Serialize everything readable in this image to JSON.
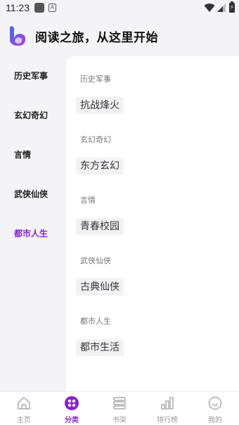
{
  "status_bar": {
    "time": "11:23",
    "a_badge": "A"
  },
  "header": {
    "title": "阅读之旅，从这里开始"
  },
  "categories": [
    {
      "label": "历史军事"
    },
    {
      "label": "玄幻奇幻"
    },
    {
      "label": "言情"
    },
    {
      "label": "武侠仙侠"
    },
    {
      "label": "都市人生",
      "active": true
    }
  ],
  "sections": [
    {
      "title": "历史军事",
      "tags": [
        "抗战烽火"
      ]
    },
    {
      "title": "玄幻奇幻",
      "tags": [
        "东方玄幻"
      ]
    },
    {
      "title": "言情",
      "tags": [
        "青春校园"
      ]
    },
    {
      "title": "武侠仙侠",
      "tags": [
        "古典仙侠"
      ]
    },
    {
      "title": "都市人生",
      "tags": [
        "都市生活"
      ]
    }
  ],
  "bottom_nav": [
    {
      "label": "主页",
      "icon": "home-icon"
    },
    {
      "label": "分类",
      "icon": "category-icon",
      "active": true
    },
    {
      "label": "书架",
      "icon": "bookshelf-icon"
    },
    {
      "label": "排行榜",
      "icon": "ranking-icon"
    },
    {
      "label": "我的",
      "icon": "profile-icon"
    }
  ],
  "colors": {
    "accent": "#8a1fd4",
    "inactive": "#9a9a9a",
    "background": "#f4f4f6"
  }
}
